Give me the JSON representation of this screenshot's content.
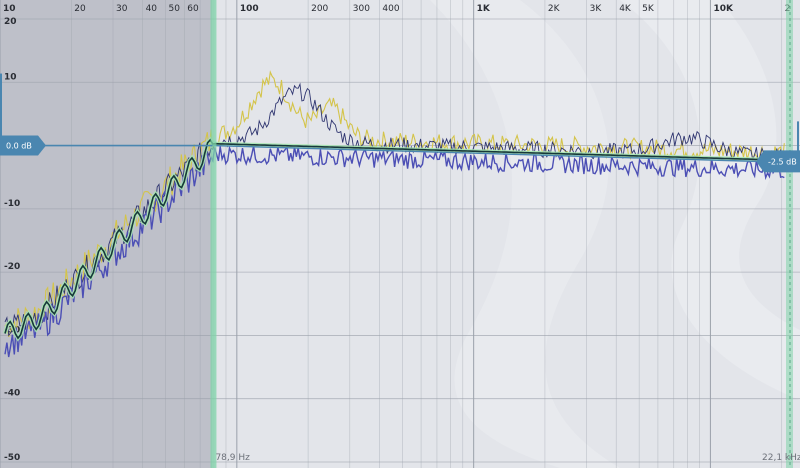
{
  "frequency_labels": [
    {
      "text": "10",
      "freq": 10,
      "bold": true
    },
    {
      "text": "20",
      "freq": 20,
      "bold": false
    },
    {
      "text": "30",
      "freq": 30,
      "bold": false
    },
    {
      "text": "40",
      "freq": 40,
      "bold": false
    },
    {
      "text": "50",
      "freq": 50,
      "bold": false
    },
    {
      "text": "60",
      "freq": 60,
      "bold": false
    },
    {
      "text": "100",
      "freq": 100,
      "bold": true
    },
    {
      "text": "200",
      "freq": 200,
      "bold": false
    },
    {
      "text": "300",
      "freq": 300,
      "bold": false
    },
    {
      "text": "400",
      "freq": 400,
      "bold": false
    },
    {
      "text": "1K",
      "freq": 1000,
      "bold": true
    },
    {
      "text": "2K",
      "freq": 2000,
      "bold": false
    },
    {
      "text": "3K",
      "freq": 3000,
      "bold": false
    },
    {
      "text": "4K",
      "freq": 4000,
      "bold": false
    },
    {
      "text": "5K",
      "freq": 5000,
      "bold": false
    },
    {
      "text": "10K",
      "freq": 10000,
      "bold": true
    },
    {
      "text": "2",
      "freq": 20000,
      "bold": false
    }
  ],
  "db_labels": [
    "20",
    "10",
    "-10",
    "-20",
    "-30",
    "-40",
    "-50"
  ],
  "db_label_values": [
    20,
    10,
    -10,
    -20,
    -30,
    -40,
    -50
  ],
  "db_range": [
    -50,
    23
  ],
  "freq_range": [
    10,
    22100
  ],
  "low_cut_label": "78,9 Hz",
  "low_cut_freq": 78.9,
  "high_cut_label": "22,1 kHz",
  "high_cut_freq": 22100,
  "low_gain_tag": "0.0 dB",
  "low_gain_db": 0.0,
  "high_gain_tag": "-2.5 dB",
  "high_gain_db": -2.5,
  "colors": {
    "background": "#e3e5ea",
    "low_band_shade": "#b7bac3",
    "grid": "#9aa0aa",
    "cut_handle": "#7fd3a8",
    "accent": "#4a86b0",
    "trace_yellow": "#d4c44a",
    "trace_blue": "#4c4fb5",
    "trace_navy": "#2f3570",
    "trace_dark": "#17383a",
    "trace_green": "#a8e6b2"
  }
}
